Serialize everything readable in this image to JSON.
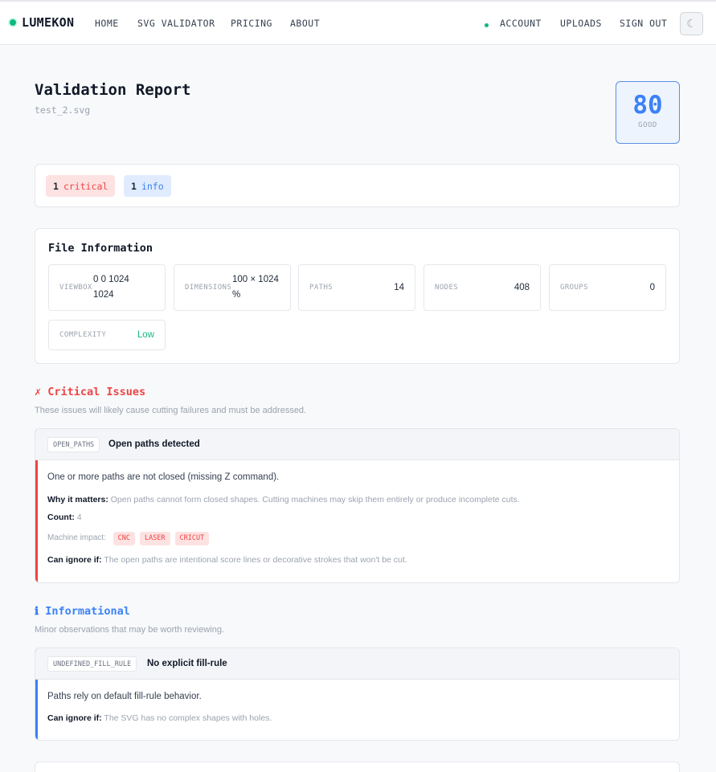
{
  "nav": {
    "brand": "LUMEKON",
    "links": [
      "HOME",
      "SVG VALIDATOR",
      "PRICING",
      "ABOUT"
    ],
    "right": [
      "ACCOUNT",
      "UPLOADS",
      "SIGN OUT"
    ],
    "theme_icon": "☾"
  },
  "report": {
    "title": "Validation Report",
    "file": "test_2.svg",
    "score": "80",
    "score_label": "GOOD"
  },
  "summary": {
    "critical_count": "1",
    "critical_label": "critical",
    "info_count": "1",
    "info_label": "info"
  },
  "file_info": {
    "heading": "File Information",
    "viewbox_label": "VIEWBOX",
    "viewbox_value": "0 0 1024 1024",
    "dimensions_label": "DIMENSIONS",
    "dimensions_value": "100 × 1024 %",
    "paths_label": "PATHS",
    "paths_value": "14",
    "nodes_label": "NODES",
    "nodes_value": "408",
    "groups_label": "GROUPS",
    "groups_value": "0",
    "complexity_label": "COMPLEXITY",
    "complexity_value": "Low"
  },
  "critical": {
    "heading": "✗ Critical Issues",
    "subheading": "These issues will likely cause cutting failures and must be addressed.",
    "issue": {
      "code": "OPEN_PATHS",
      "title": "Open paths detected",
      "description": "One or more paths are not closed (missing Z command).",
      "why_label": "Why it matters:",
      "why_text": "Open paths cannot form closed shapes. Cutting machines may skip them entirely or produce incomplete cuts.",
      "count_label": "Count:",
      "count_value": "4",
      "impact_label": "Machine impact:",
      "machines": [
        "CNC",
        "LASER",
        "CRICUT"
      ],
      "ignore_label": "Can ignore if:",
      "ignore_text": "The open paths are intentional score lines or decorative strokes that won't be cut."
    }
  },
  "informational": {
    "heading": "ℹ Informational",
    "subheading": "Minor observations that may be worth reviewing.",
    "issue": {
      "code": "UNDEFINED_FILL_RULE",
      "title": "No explicit fill-rule",
      "description": "Paths rely on default fill-rule behavior.",
      "ignore_label": "Can ignore if:",
      "ignore_text": "The SVG has no complex shapes with holes."
    }
  },
  "colors": {
    "critical": "#ef4444",
    "info": "#3b82f6",
    "good": "#10b981"
  }
}
